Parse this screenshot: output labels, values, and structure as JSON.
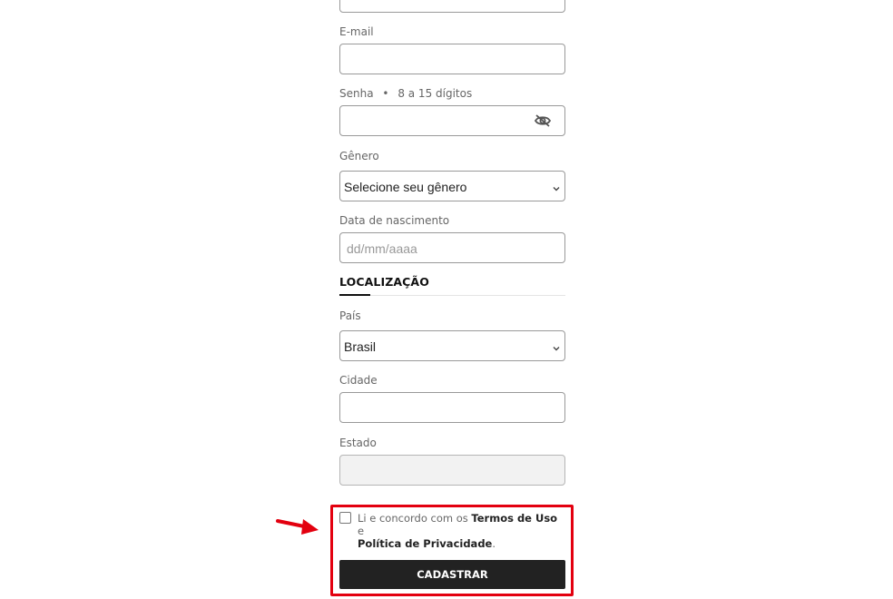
{
  "form": {
    "email": {
      "label": "E-mail",
      "value": ""
    },
    "senha": {
      "label": "Senha",
      "separator": "•",
      "hint": "8 a 15 dígitos",
      "value": ""
    },
    "genero": {
      "label": "Gênero",
      "selected": "Selecione seu gênero"
    },
    "nascimento": {
      "label": "Data de nascimento",
      "placeholder": "dd/mm/aaaa"
    },
    "localizacao_title": "LOCALIZAÇÃO",
    "pais": {
      "label": "País",
      "selected": "Brasil"
    },
    "cidade": {
      "label": "Cidade",
      "value": ""
    },
    "estado": {
      "label": "Estado",
      "value": ""
    },
    "consent": {
      "prefix": "Li e concordo com os ",
      "terms": "Termos de Uso",
      "middle": " e",
      "privacy": "Política de Privacidade",
      "suffix": "."
    },
    "submit_label": "CADASTRAR"
  },
  "icons": {
    "password_toggle": "eye-slash-icon",
    "dropdown": "chevron-down-icon",
    "annotation": "red-arrow-icon"
  },
  "colors": {
    "annotation": "#e3000f",
    "button_bg": "#222222",
    "field_border": "#999999"
  }
}
